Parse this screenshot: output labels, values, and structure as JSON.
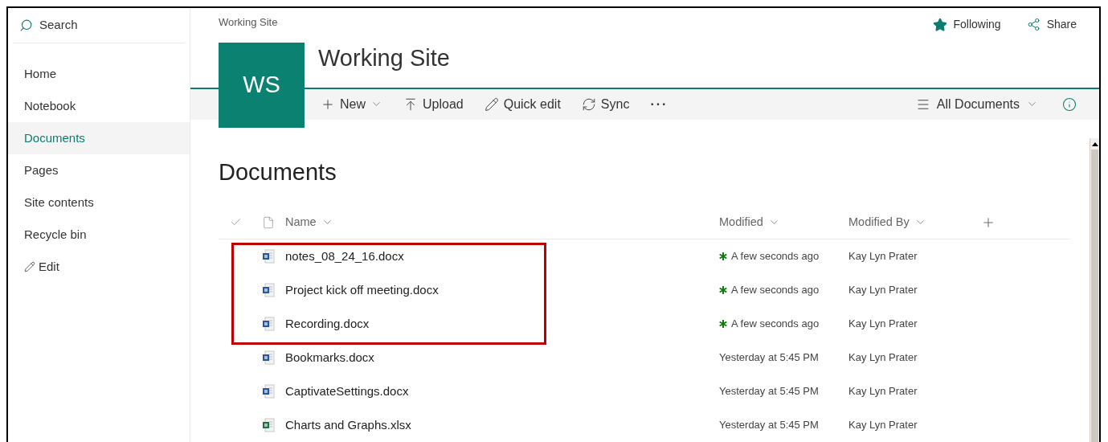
{
  "sidebar": {
    "search": {
      "label": "Search"
    },
    "items": [
      {
        "label": "Home",
        "selected": false
      },
      {
        "label": "Notebook",
        "selected": false
      },
      {
        "label": "Documents",
        "selected": true
      },
      {
        "label": "Pages",
        "selected": false
      },
      {
        "label": "Site contents",
        "selected": false
      },
      {
        "label": "Recycle bin",
        "selected": false
      }
    ],
    "edit_link": "Edit"
  },
  "site": {
    "breadcrumb": "Working Site",
    "logo": "WS",
    "title": "Working Site",
    "following": "Following",
    "share": "Share"
  },
  "command_bar": {
    "commands": [
      {
        "kind": "new",
        "label": "New"
      },
      {
        "kind": "upload",
        "label": "Upload"
      },
      {
        "kind": "quick-edit",
        "label": "Quick edit"
      },
      {
        "kind": "sync",
        "label": "Sync"
      },
      {
        "kind": "more",
        "label": "···"
      }
    ],
    "view": "All Documents"
  },
  "library": {
    "title": "Documents",
    "columns": {
      "name": "Name",
      "modified": "Modified",
      "modified_by": "Modified By"
    },
    "rows": [
      {
        "kind": "word",
        "name": "notes_08_24_16.docx",
        "modified": "A few seconds ago",
        "modified_by": "Kay Lyn Prater",
        "new": true,
        "highlighted": true
      },
      {
        "kind": "word",
        "name": "Project kick off meeting.docx",
        "modified": "A few seconds ago",
        "modified_by": "Kay Lyn Prater",
        "new": true,
        "highlighted": true
      },
      {
        "kind": "word",
        "name": "Recording.docx",
        "modified": "A few seconds ago",
        "modified_by": "Kay Lyn Prater",
        "new": true,
        "highlighted": true
      },
      {
        "kind": "word",
        "name": "Bookmarks.docx",
        "modified": "Yesterday at 5:45 PM",
        "modified_by": "Kay Lyn Prater",
        "new": false,
        "highlighted": false
      },
      {
        "kind": "word",
        "name": "CaptivateSettings.docx",
        "modified": "Yesterday at 5:45 PM",
        "modified_by": "Kay Lyn Prater",
        "new": false,
        "highlighted": false
      },
      {
        "kind": "excel",
        "name": "Charts and Graphs.xlsx",
        "modified": "Yesterday at 5:45 PM",
        "modified_by": "Kay Lyn Prater",
        "new": false,
        "highlighted": false
      }
    ]
  }
}
